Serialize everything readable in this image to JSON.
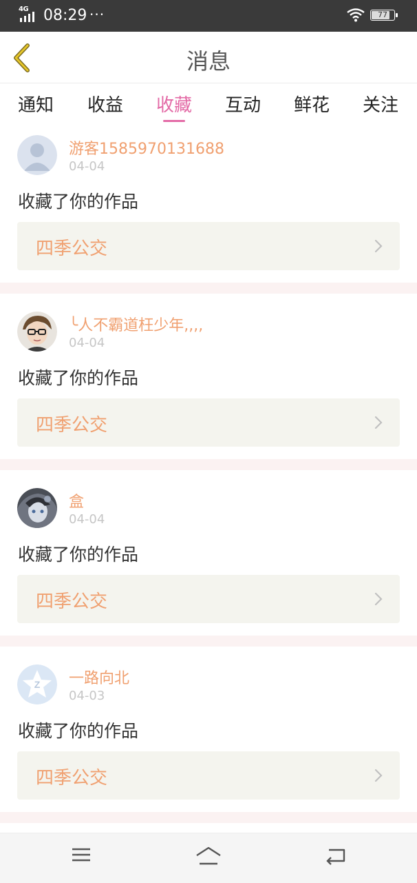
{
  "status_bar": {
    "network": "4G",
    "time": "08:29",
    "more": "···",
    "battery": "77"
  },
  "header": {
    "title": "消息",
    "back_icon": "back-chevron-icon"
  },
  "tabs": [
    {
      "label": "通知"
    },
    {
      "label": "收益"
    },
    {
      "label": "收藏",
      "active": true
    },
    {
      "label": "互动"
    },
    {
      "label": "鲜花"
    },
    {
      "label": "关注"
    }
  ],
  "colors": {
    "accent": "#e36aa6",
    "username": "#f0a070",
    "work_bg": "#f4f4ee"
  },
  "items": [
    {
      "username": "游客1585970131688",
      "date": "04-04",
      "action": "收藏了你的作品",
      "work": "四季公交",
      "avatar": "default-user-avatar"
    },
    {
      "username": "╰人不霸道枉少年,,,,",
      "date": "04-04",
      "action": "收藏了你的作品",
      "work": "四季公交",
      "avatar": "boy-glasses-avatar"
    },
    {
      "username": "盒",
      "date": "04-04",
      "action": "收藏了你的作品",
      "work": "四季公交",
      "avatar": "anime-avatar"
    },
    {
      "username": "一路向北",
      "date": "04-03",
      "action": "收藏了你的作品",
      "work": "四季公交",
      "avatar": "qq-star-avatar"
    }
  ],
  "nav": [
    "menu-icon",
    "home-icon",
    "back-icon"
  ]
}
